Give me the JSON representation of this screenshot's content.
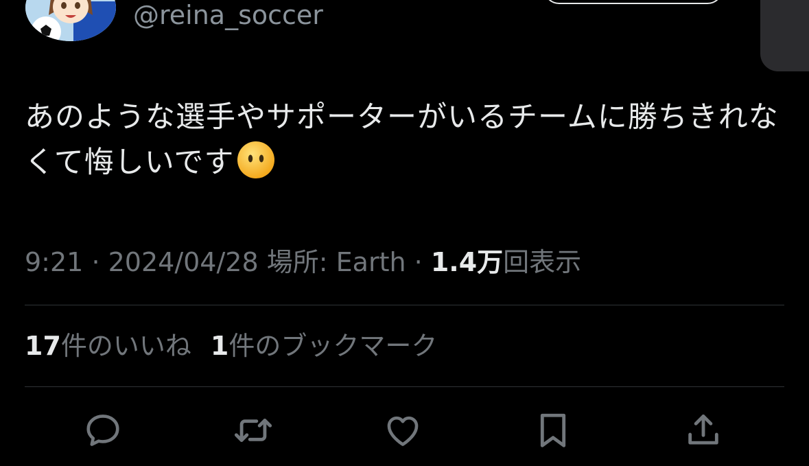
{
  "header": {
    "handle": "@reina_soccer",
    "avatar_icon": "avatar-image"
  },
  "tweet": {
    "text": "あのような選手やサポーターがいるチームに勝ちきれなくて悔しいです",
    "emoji_icon": "face-without-mouth-emoji"
  },
  "meta": {
    "time": "9:21",
    "date": "2024/04/28",
    "location_label": "場所:",
    "location": "Earth",
    "views_count": "1.4万",
    "views_label": "回表示",
    "separator": "·"
  },
  "stats": {
    "likes_count": "17",
    "likes_label": "件のいいね",
    "bookmarks_count": "1",
    "bookmarks_label": "件のブックマーク"
  },
  "actions": [
    {
      "icon": "reply-icon"
    },
    {
      "icon": "retweet-icon"
    },
    {
      "icon": "like-icon"
    },
    {
      "icon": "bookmark-icon"
    },
    {
      "icon": "share-icon"
    }
  ],
  "colors": {
    "background": "#000000",
    "text": "#e7e9ea",
    "muted": "#71767b",
    "divider": "#2f3336"
  }
}
